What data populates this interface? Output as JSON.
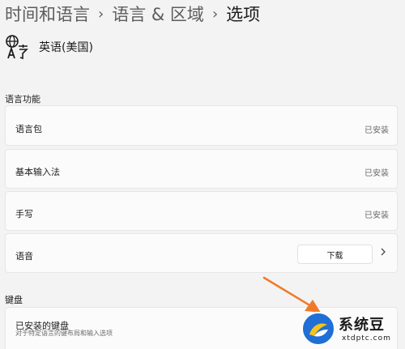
{
  "breadcrumb": {
    "items": [
      "时间和语言",
      "语言 & 区域"
    ],
    "current": "选项",
    "separator": "›"
  },
  "language": {
    "name": "英语(美国)",
    "icon": "language-globe-icon"
  },
  "sections": {
    "language_features": "语言功能",
    "keyboard": "键盘"
  },
  "language_rows": [
    {
      "label": "语言包",
      "status": "已安装"
    },
    {
      "label": "基本输入法",
      "status": "已安装"
    },
    {
      "label": "手写",
      "status": "已安装"
    },
    {
      "label": "语音",
      "button": "下载"
    }
  ],
  "keyboard_row": {
    "label": "已安装的键盘",
    "sublabel": "对于特定语言的键布局和输入选项"
  },
  "watermark": {
    "title": "系统豆",
    "url": "xtdptc.com"
  },
  "colors": {
    "background": "#f3f3f3",
    "card": "#fbfbfb",
    "annotation_arrow": "#f07a2a",
    "watermark_blue": "#1f6fd6",
    "watermark_yellow": "#f6c31a"
  }
}
